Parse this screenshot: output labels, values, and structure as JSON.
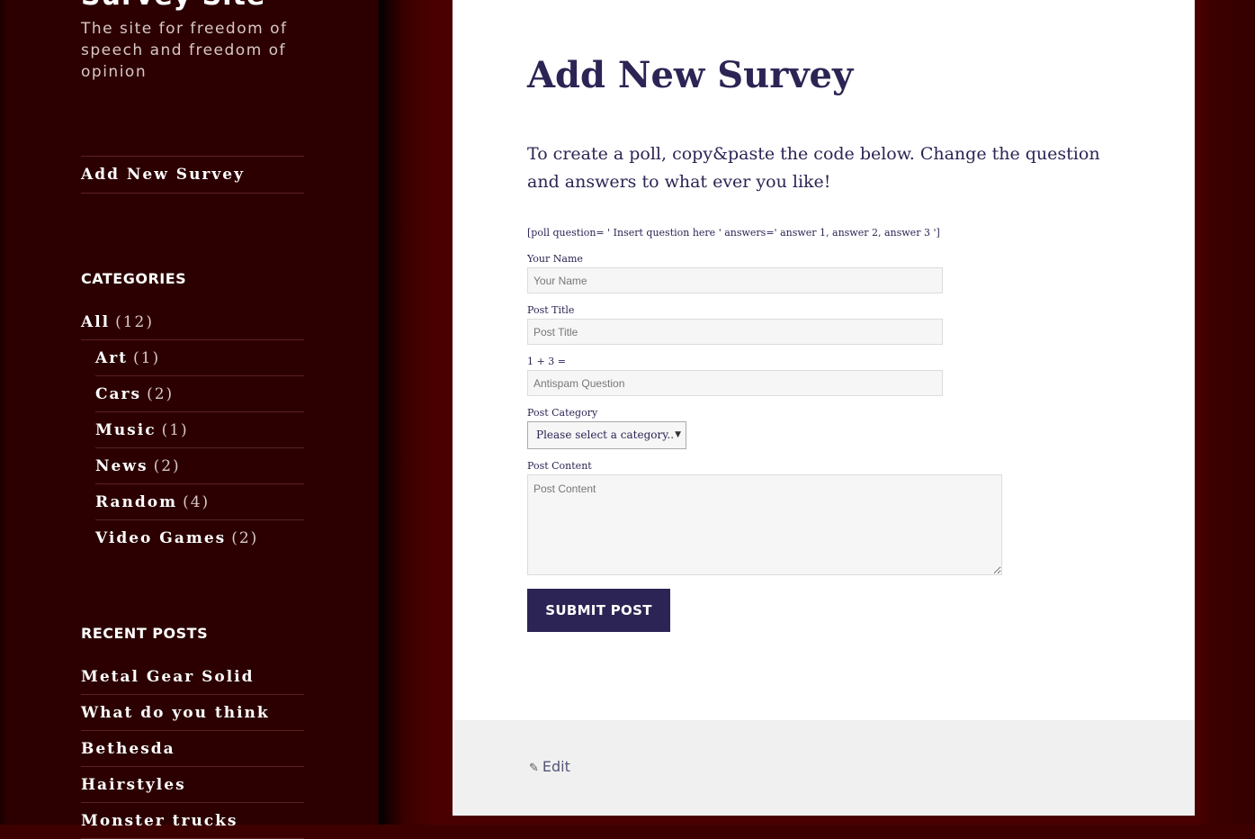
{
  "site": {
    "title": "Survey Site",
    "description": "The site for freedom of speech and freedom of opinion"
  },
  "menu": {
    "items": [
      {
        "label": "Add New Survey"
      }
    ]
  },
  "categories": {
    "heading": "CATEGORIES",
    "items": [
      {
        "name": "All",
        "count": "(12)"
      },
      {
        "name": "Art",
        "count": "(1)"
      },
      {
        "name": "Cars",
        "count": "(2)"
      },
      {
        "name": "Music",
        "count": "(1)"
      },
      {
        "name": "News",
        "count": "(2)"
      },
      {
        "name": "Random",
        "count": "(4)"
      },
      {
        "name": "Video Games",
        "count": "(2)"
      }
    ]
  },
  "recent_posts": {
    "heading": "RECENT POSTS",
    "items": [
      {
        "title": "Metal Gear Solid"
      },
      {
        "title": "What do you think"
      },
      {
        "title": "Bethesda"
      },
      {
        "title": "Hairstyles"
      },
      {
        "title": "Monster trucks"
      }
    ]
  },
  "page": {
    "title": "Add New Survey",
    "intro": "To create a poll, copy&paste the code below. Change the question and answers to what ever you like!",
    "shortcode": "[poll question= ' Insert question here ' answers=' answer 1, answer 2, answer 3 ']"
  },
  "form": {
    "name_label": "Your Name",
    "name_placeholder": "Your Name",
    "title_label": "Post Title",
    "title_placeholder": "Post Title",
    "antispam_label": "1 + 3 =",
    "antispam_placeholder": "Antispam Question",
    "category_label": "Post Category",
    "category_selected": "Please select a category..",
    "content_label": "Post Content",
    "content_placeholder": "Post Content",
    "submit_label": "Submit Post"
  },
  "footer": {
    "edit_label": "Edit"
  }
}
